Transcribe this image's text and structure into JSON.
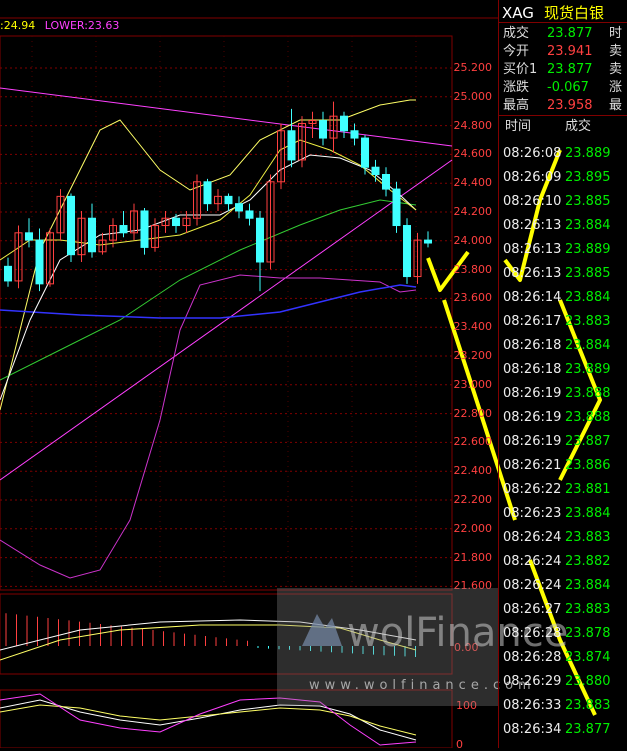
{
  "indicator_header": {
    "upper": ":24.94",
    "lower": "LOWER:23.63"
  },
  "price_axis": [
    "25.200",
    "25.000",
    "24.800",
    "24.600",
    "24.400",
    "24.200",
    "24.000",
    "23.800",
    "23.600",
    "23.400",
    "23.200",
    "23.000",
    "22.800",
    "22.600",
    "22.400",
    "22.200",
    "22.000",
    "21.800",
    "21.600"
  ],
  "macd_axis": [
    "0.00"
  ],
  "kdj_axis": [
    "100",
    "0"
  ],
  "watermark": {
    "brand": "wolFinance",
    "url": "www.wolfinance.com"
  },
  "quote": {
    "code": "XAG",
    "name": "现货白银",
    "rows": [
      {
        "label": "成交",
        "value": "23.877",
        "color": "#00ee00",
        "right": "时"
      },
      {
        "label": "今开",
        "value": "23.941",
        "color": "#ff4040",
        "right": "卖"
      },
      {
        "label": "买价1",
        "value": "23.877",
        "color": "#00ee00",
        "right": "卖"
      },
      {
        "label": "涨跌",
        "value": "-0.067",
        "color": "#00ee00",
        "right": "涨"
      },
      {
        "label": "最高",
        "value": "23.958",
        "color": "#ff4040",
        "right": "最"
      }
    ]
  },
  "ticks": {
    "header_time": "时间",
    "header_price": "成交",
    "rows": [
      {
        "time": "08:26:08",
        "price": "23.889"
      },
      {
        "time": "08:26:09",
        "price": "23.895"
      },
      {
        "time": "08:26:10",
        "price": "23.885"
      },
      {
        "time": "08:26:13",
        "price": "23.884"
      },
      {
        "time": "08:26:13",
        "price": "23.889"
      },
      {
        "time": "08:26:13",
        "price": "23.885"
      },
      {
        "time": "08:26:14",
        "price": "23.884"
      },
      {
        "time": "08:26:17",
        "price": "23.883"
      },
      {
        "time": "08:26:18",
        "price": "23.884"
      },
      {
        "time": "08:26:18",
        "price": "23.889"
      },
      {
        "time": "08:26:19",
        "price": "23.888"
      },
      {
        "time": "08:26:19",
        "price": "23.888"
      },
      {
        "time": "08:26:19",
        "price": "23.887"
      },
      {
        "time": "08:26:21",
        "price": "23.886"
      },
      {
        "time": "08:26:22",
        "price": "23.881"
      },
      {
        "time": "08:26:23",
        "price": "23.884"
      },
      {
        "time": "08:26:24",
        "price": "23.883"
      },
      {
        "time": "08:26:24",
        "price": "23.882"
      },
      {
        "time": "08:26:24",
        "price": "23.884"
      },
      {
        "time": "08:26:27",
        "price": "23.883"
      },
      {
        "time": "08:26:28",
        "price": "23.878"
      },
      {
        "time": "08:26:28",
        "price": "23.874"
      },
      {
        "time": "08:26:29",
        "price": "23.880"
      },
      {
        "time": "08:26:33",
        "price": "23.883"
      },
      {
        "time": "08:26:34",
        "price": "23.877"
      }
    ]
  },
  "chart_data": {
    "type": "candlestick",
    "ylim": [
      21.5,
      25.3
    ],
    "candles": [
      {
        "o": 23.72,
        "h": 23.78,
        "l": 23.58,
        "c": 23.62
      },
      {
        "o": 23.62,
        "h": 24.0,
        "l": 23.57,
        "c": 23.95
      },
      {
        "o": 23.95,
        "h": 24.05,
        "l": 23.85,
        "c": 23.9
      },
      {
        "o": 23.9,
        "h": 23.98,
        "l": 23.55,
        "c": 23.6
      },
      {
        "o": 23.6,
        "h": 23.98,
        "l": 23.58,
        "c": 23.95
      },
      {
        "o": 23.95,
        "h": 24.25,
        "l": 23.9,
        "c": 24.2
      },
      {
        "o": 24.2,
        "h": 24.22,
        "l": 23.75,
        "c": 23.8
      },
      {
        "o": 23.8,
        "h": 24.1,
        "l": 23.75,
        "c": 24.05
      },
      {
        "o": 24.05,
        "h": 24.15,
        "l": 23.78,
        "c": 23.82
      },
      {
        "o": 23.82,
        "h": 23.95,
        "l": 23.8,
        "c": 23.9
      },
      {
        "o": 23.9,
        "h": 24.05,
        "l": 23.85,
        "c": 24.0
      },
      {
        "o": 24.0,
        "h": 24.1,
        "l": 23.92,
        "c": 23.95
      },
      {
        "o": 23.95,
        "h": 24.15,
        "l": 23.9,
        "c": 24.1
      },
      {
        "o": 24.1,
        "h": 24.12,
        "l": 23.8,
        "c": 23.85
      },
      {
        "o": 23.85,
        "h": 24.05,
        "l": 23.82,
        "c": 24.0
      },
      {
        "o": 24.0,
        "h": 24.1,
        "l": 23.95,
        "c": 24.05
      },
      {
        "o": 24.05,
        "h": 24.08,
        "l": 23.95,
        "c": 24.0
      },
      {
        "o": 24.0,
        "h": 24.1,
        "l": 23.95,
        "c": 24.05
      },
      {
        "o": 24.05,
        "h": 24.35,
        "l": 24.0,
        "c": 24.3
      },
      {
        "o": 24.3,
        "h": 24.32,
        "l": 24.1,
        "c": 24.15
      },
      {
        "o": 24.15,
        "h": 24.25,
        "l": 24.1,
        "c": 24.2
      },
      {
        "o": 24.2,
        "h": 24.22,
        "l": 24.1,
        "c": 24.15
      },
      {
        "o": 24.15,
        "h": 24.2,
        "l": 24.05,
        "c": 24.1
      },
      {
        "o": 24.1,
        "h": 24.15,
        "l": 24.0,
        "c": 24.05
      },
      {
        "o": 24.05,
        "h": 24.1,
        "l": 23.55,
        "c": 23.75
      },
      {
        "o": 23.75,
        "h": 24.35,
        "l": 23.7,
        "c": 24.3
      },
      {
        "o": 24.3,
        "h": 24.7,
        "l": 24.25,
        "c": 24.65
      },
      {
        "o": 24.65,
        "h": 24.8,
        "l": 24.4,
        "c": 24.45
      },
      {
        "o": 24.45,
        "h": 24.75,
        "l": 24.4,
        "c": 24.7
      },
      {
        "o": 24.7,
        "h": 24.78,
        "l": 24.6,
        "c": 24.72
      },
      {
        "o": 24.72,
        "h": 24.78,
        "l": 24.55,
        "c": 24.6
      },
      {
        "o": 24.6,
        "h": 24.85,
        "l": 24.5,
        "c": 24.75
      },
      {
        "o": 24.75,
        "h": 24.78,
        "l": 24.6,
        "c": 24.65
      },
      {
        "o": 24.65,
        "h": 24.7,
        "l": 24.55,
        "c": 24.6
      },
      {
        "o": 24.6,
        "h": 24.62,
        "l": 24.35,
        "c": 24.4
      },
      {
        "o": 24.4,
        "h": 24.45,
        "l": 24.3,
        "c": 24.35
      },
      {
        "o": 24.35,
        "h": 24.4,
        "l": 24.2,
        "c": 24.25
      },
      {
        "o": 24.25,
        "h": 24.3,
        "l": 23.95,
        "c": 24.0
      },
      {
        "o": 24.0,
        "h": 24.05,
        "l": 23.6,
        "c": 23.65
      },
      {
        "o": 23.65,
        "h": 23.95,
        "l": 23.6,
        "c": 23.9
      },
      {
        "o": 23.9,
        "h": 23.96,
        "l": 23.85,
        "c": 23.88
      }
    ]
  }
}
